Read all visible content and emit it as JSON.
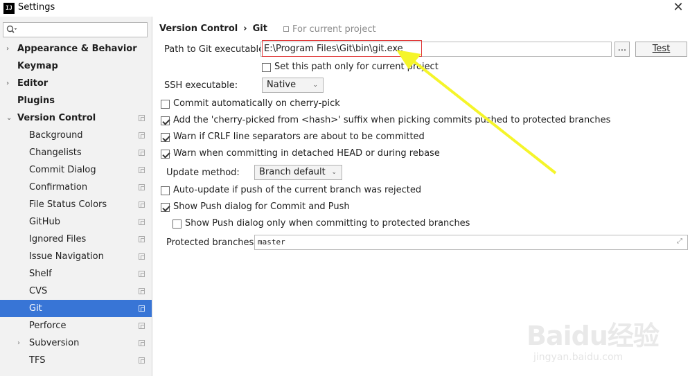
{
  "window": {
    "title": "Settings",
    "app_icon_text": "IJ"
  },
  "sidebar": {
    "search_placeholder": "",
    "items": [
      {
        "label": "Appearance & Behavior",
        "level": 0,
        "bold": true,
        "arrow": "›"
      },
      {
        "label": "Keymap",
        "level": 0,
        "bold": true,
        "arrow": ""
      },
      {
        "label": "Editor",
        "level": 0,
        "bold": true,
        "arrow": "›"
      },
      {
        "label": "Plugins",
        "level": 0,
        "bold": true,
        "arrow": ""
      },
      {
        "label": "Version Control",
        "level": 0,
        "bold": true,
        "arrow": "⌄"
      },
      {
        "label": "Background",
        "level": 1
      },
      {
        "label": "Changelists",
        "level": 1
      },
      {
        "label": "Commit Dialog",
        "level": 1
      },
      {
        "label": "Confirmation",
        "level": 1
      },
      {
        "label": "File Status Colors",
        "level": 1
      },
      {
        "label": "GitHub",
        "level": 1
      },
      {
        "label": "Ignored Files",
        "level": 1
      },
      {
        "label": "Issue Navigation",
        "level": 1
      },
      {
        "label": "Shelf",
        "level": 1
      },
      {
        "label": "CVS",
        "level": 1
      },
      {
        "label": "Git",
        "level": 1,
        "selected": true
      },
      {
        "label": "Perforce",
        "level": 1
      },
      {
        "label": "Subversion",
        "level": 1,
        "arrow": "›"
      },
      {
        "label": "TFS",
        "level": 1
      }
    ]
  },
  "content": {
    "breadcrumb": [
      "Version Control",
      "Git"
    ],
    "project_hint": "For current project",
    "path_label": "Path to Git executable:",
    "path_value": "E:\\Program Files\\Git\\bin\\git.exe",
    "browse_label": "...",
    "test_label": "Test",
    "path_only_current": "Set this path only for current project",
    "ssh_label": "SSH executable:",
    "ssh_value": "Native",
    "options": [
      {
        "label": "Commit automatically on cherry-pick",
        "checked": false
      },
      {
        "label": "Add the 'cherry-picked from <hash>' suffix when picking commits pushed to protected branches",
        "checked": true
      },
      {
        "label": "Warn if CRLF line separators are about to be committed",
        "checked": true
      },
      {
        "label": "Warn when committing in detached HEAD or during rebase",
        "checked": true
      }
    ],
    "update_label": "Update method:",
    "update_value": "Branch default",
    "auto_update": {
      "label": "Auto-update if push of the current branch was rejected",
      "checked": false
    },
    "show_push": {
      "label": "Show Push dialog for Commit and Push",
      "checked": true
    },
    "show_push_protected": {
      "label": "Show Push dialog only when committing to protected branches",
      "checked": false
    },
    "protected_label": "Protected branches:",
    "protected_value": "master"
  },
  "watermark": {
    "text": "Baidu经验",
    "sub": "jingyan.baidu.com"
  },
  "colors": {
    "selection": "#3875d6",
    "highlight_box": "#e03a3a",
    "arrow": "#f5f52a"
  }
}
